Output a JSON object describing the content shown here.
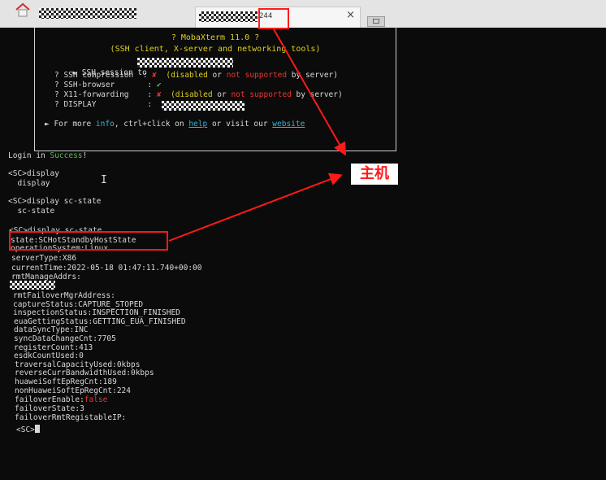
{
  "tab": {
    "number": "244",
    "close": "×"
  },
  "banner": {
    "title_line1": "? MobaXterm 11.0 ?",
    "title_line2": "(SSH client, X-server and networking tools)",
    "session_prefix": "► SSH session to",
    "rows": [
      {
        "label": "? SSH compression",
        "colon": ":",
        "mark": "✘",
        "parts": [
          "(disabled",
          " or ",
          "not supported",
          " by server)"
        ]
      },
      {
        "label": "? SSH-browser",
        "colon": ":",
        "mark": "✔"
      },
      {
        "label": "? X11-forwarding",
        "colon": ":",
        "mark": "✘",
        "parts": [
          "(disabled",
          " or ",
          "not supported",
          " by server)"
        ]
      },
      {
        "label": "? DISPLAY",
        "colon": ":"
      }
    ],
    "more_prefix": "► For more ",
    "more_info": "info",
    "more_mid": ", ctrl+click on ",
    "more_help": "help",
    "more_or": " or visit our ",
    "more_website": "website"
  },
  "terminal": {
    "login_prefix": "Login in ",
    "login_success": "Success",
    "login_suffix": "!",
    "cmd1": "<SC>display",
    "cmd1_echo": "  display",
    "cmd2": "<SC>display sc-state",
    "cmd2_echo": "  sc-state",
    "cmd3": "<SC>display sc-state",
    "state": "state:SCHotStandbyHostState",
    "operating": "operationSystem:Linux",
    "server_type": "serverType:X86",
    "current_time": "currentTime:2022-05-18 01:47:11.740+00:00",
    "rmt_manage": "rmtManageAddrs:",
    "lines": [
      "rmtFailoverMgrAddress:",
      "captureStatus:CAPTURE_STOPED",
      "inspectionStatus:INSPECTION_FINISHED",
      "euaGettingStatus:GETTING_EUA_FINISHED",
      "dataSyncType:INC",
      "syncDataChangeCnt:7705",
      "registerCount:413",
      "esdkCountUsed:0",
      "traversalCapacityUsed:0kbps",
      "reverseCurrBandwidthUsed:0kbps",
      "huaweiSoftEpRegCnt:189",
      "nonHuaweiSoftEpRegCnt:224"
    ],
    "failover_enable_label": "failoverEnable:",
    "failover_enable_value": "false",
    "failover_state": "failoverState:3",
    "failover_rmt": "failoverRmtRegistableIP:",
    "prompt": "<SC>"
  },
  "annotation": {
    "label": "主机",
    "color": "#ff1a1a"
  }
}
